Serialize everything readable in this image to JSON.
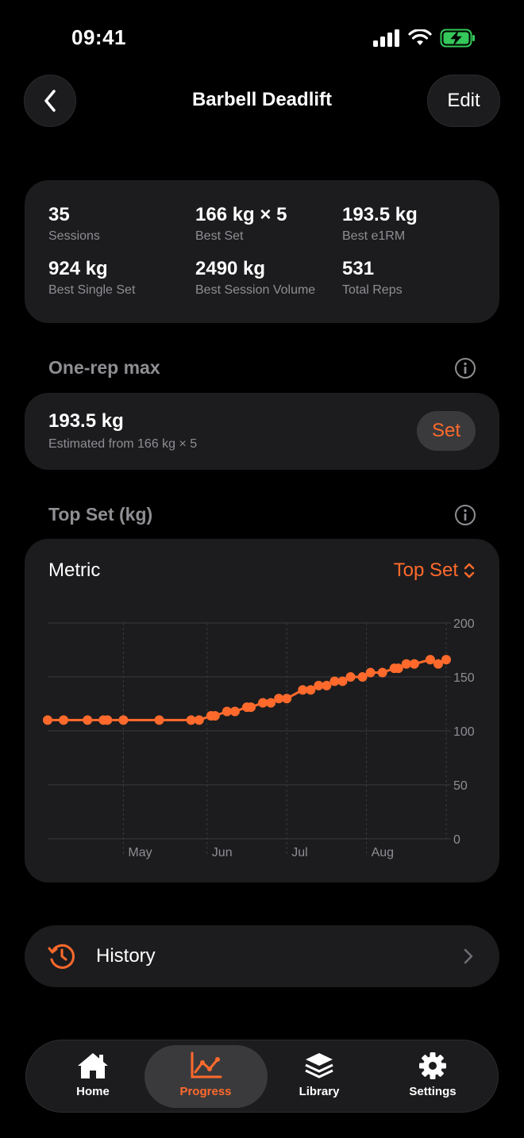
{
  "status": {
    "time": "09:41"
  },
  "nav": {
    "title": "Barbell Deadlift",
    "edit_label": "Edit"
  },
  "stats": [
    {
      "value": "35",
      "label": "Sessions"
    },
    {
      "value": "166 kg × 5",
      "label": "Best Set"
    },
    {
      "value": "193.5 kg",
      "label": "Best e1RM"
    },
    {
      "value": "924 kg",
      "label": "Best Single Set"
    },
    {
      "value": "2490 kg",
      "label": "Best Session Volume"
    },
    {
      "value": "531",
      "label": "Total Reps"
    }
  ],
  "one_rep_max": {
    "section_title": "One-rep max",
    "value": "193.5 kg",
    "subtitle": "Estimated from 166 kg × 5",
    "set_label": "Set"
  },
  "top_set_section": {
    "title": "Top Set (kg)"
  },
  "metric": {
    "label": "Metric",
    "selected": "Top Set"
  },
  "chart_data": {
    "type": "line",
    "series": [
      {
        "color": "#ff6a2c",
        "x": [
          0,
          0.04,
          0.1,
          0.14,
          0.15,
          0.19,
          0.28,
          0.36,
          0.38,
          0.41,
          0.42,
          0.45,
          0.47,
          0.5,
          0.51,
          0.54,
          0.56,
          0.58,
          0.6,
          0.64,
          0.66,
          0.68,
          0.7,
          0.72,
          0.74,
          0.76,
          0.79,
          0.81,
          0.84,
          0.87,
          0.88,
          0.9,
          0.92,
          0.96,
          0.98,
          1.0
        ],
        "y": [
          110,
          110,
          110,
          110,
          110,
          110,
          110,
          110,
          110,
          114,
          114,
          118,
          118,
          122,
          122,
          126,
          126,
          130,
          130,
          138,
          138,
          142,
          142,
          146,
          146,
          150,
          150,
          154,
          154,
          158,
          158,
          162,
          162,
          166,
          162,
          166
        ]
      }
    ],
    "x_tick_labels": [
      "May",
      "Jun",
      "Jul",
      "Aug"
    ],
    "y_ticks": [
      0,
      50,
      100,
      150,
      200
    ],
    "ylim": [
      0,
      200
    ],
    "grid": true
  },
  "history": {
    "label": "History"
  },
  "tabs": [
    {
      "label": "Home",
      "icon": "house-icon"
    },
    {
      "label": "Progress",
      "icon": "chart-icon",
      "active": true
    },
    {
      "label": "Library",
      "icon": "stack-icon"
    },
    {
      "label": "Settings",
      "icon": "gear-icon"
    }
  ],
  "colors": {
    "accent": "#ff6a2c",
    "card": "#1c1c1e",
    "secondary_text": "#8e8e93"
  }
}
